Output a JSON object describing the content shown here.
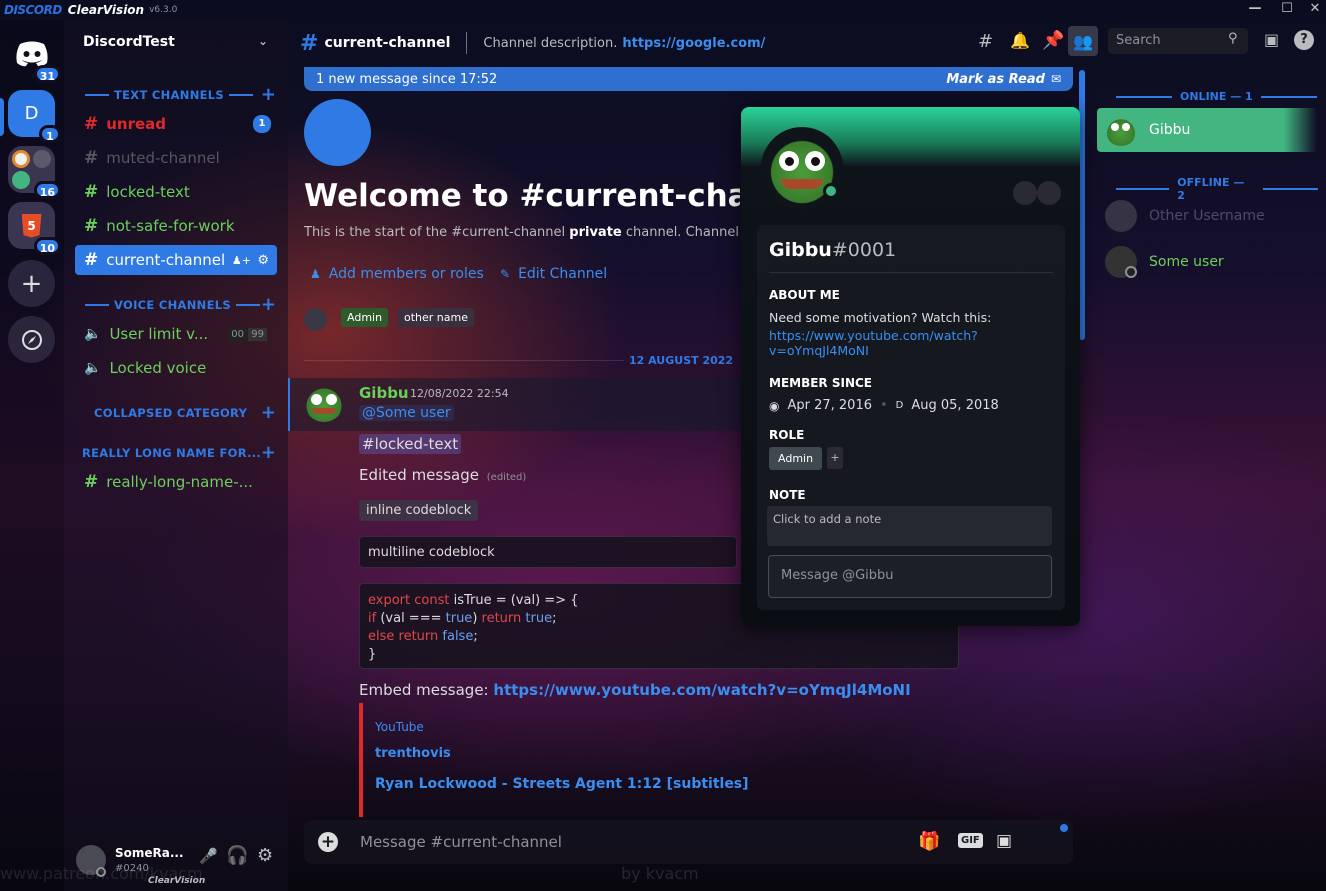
{
  "app": {
    "brand": "DISCORD",
    "name": "ClearVision",
    "version": "v6.3.0"
  },
  "window": {
    "minimize": "—",
    "maximize": "☐",
    "close": "✕"
  },
  "servers": [
    {
      "name": "home",
      "badge": "31"
    },
    {
      "name": "D",
      "badge": "1"
    },
    {
      "name": "overwatch-folder",
      "badge": "16"
    },
    {
      "name": "html5",
      "badge": "10"
    },
    {
      "name": "add-server",
      "label": "+"
    },
    {
      "name": "explore",
      "label": "⊘"
    }
  ],
  "guild": {
    "name": "DiscordTest"
  },
  "categories": {
    "text": "TEXT CHANNELS",
    "voice": "VOICE CHANNELS",
    "collapsed": "COLLAPSED CATEGORY",
    "long": "REALLY LONG NAME FOR..."
  },
  "channels": {
    "unread": {
      "name": "unread",
      "badge": "1"
    },
    "muted": {
      "name": "muted-channel"
    },
    "locked": {
      "name": "locked-text"
    },
    "nsfw": {
      "name": "not-safe-for-work"
    },
    "current": {
      "name": "current-channel"
    },
    "voice_limit": {
      "name": "User limit v...",
      "count": "00",
      "limit": "99"
    },
    "locked_voice": {
      "name": "Locked voice"
    },
    "long": {
      "name": "really-long-name-..."
    }
  },
  "user_panel": {
    "name": "SomeRa...",
    "tag": "#0240",
    "footer": "ClearVision"
  },
  "header": {
    "channel": "current-channel",
    "description": "Channel description.",
    "link": "https://google.com/",
    "search_placeholder": "Search"
  },
  "banner": {
    "text": "1 new message since 17:52",
    "action": "Mark as Read"
  },
  "welcome": {
    "title": "Welcome to #current-channel",
    "subtitle_a": "This is the start of the #current-channel ",
    "subtitle_b": "private",
    "subtitle_c": " channel. Channel d",
    "add_members": "Add members or roles",
    "edit_channel": "Edit Channel",
    "roles": [
      "Admin",
      "other name"
    ]
  },
  "divider": {
    "date": "12 AUGUST 2022"
  },
  "message": {
    "author": "Gibbu",
    "timestamp": "12/08/2022 22:54",
    "mention": "@Some user",
    "channel_mention": "#locked-text",
    "edited_text": "Edited message",
    "edited_tag": "(edited)",
    "inline_code": "inline codeblock",
    "multiline_code": "multiline codeblock",
    "code_lines": {
      "l1_kw": "export const",
      "l1_rest": " isTrue = (val) => {",
      "l2_a": "  if",
      "l2_b": " (val === ",
      "l2_c": "true",
      "l2_d": ") ",
      "l2_e": "return",
      "l2_f": " true",
      "l2_g": ";",
      "l3_a": "  else return",
      "l3_b": " false",
      "l3_c": ";",
      "l4": "}"
    },
    "embed_label": "Embed message:",
    "embed_link": "https://www.youtube.com/watch?v=oYmqJl4MoNI",
    "embed_provider": "YouTube",
    "embed_author": "trenthovis",
    "embed_title": "Ryan Lockwood - Streets Agent 1:12 [subtitles]"
  },
  "popout": {
    "username": "Gibbu",
    "discriminator": "#0001",
    "about_label": "ABOUT ME",
    "about_text": "Need some motivation? Watch this:",
    "about_link_1": "https://www.youtube.com/watch?",
    "about_link_2": "v=oYmqJl4MoNI",
    "member_since_label": "MEMBER SINCE",
    "discord_date": "Apr 27, 2016",
    "server_date": "Aug 05, 2018",
    "server_initial": "D",
    "role_label": "ROLE",
    "role": "Admin",
    "role_add": "+",
    "note_label": "NOTE",
    "note_placeholder": "Click to add a note",
    "message_placeholder": "Message @Gibbu"
  },
  "members": {
    "online_label": "ONLINE — 1",
    "offline_label": "OFFLINE — 2",
    "online": [
      {
        "name": "Gibbu"
      }
    ],
    "offline": [
      {
        "name": "Other Username"
      },
      {
        "name": "Some user"
      }
    ]
  },
  "input": {
    "placeholder": "Message #current-channel",
    "gif": "GIF"
  },
  "watermark": {
    "left": "www.patreon.com/kvacm",
    "right": "by kvacm"
  },
  "colors": {
    "accent": "#2f7ae5",
    "online": "#43b581",
    "unread": "#e02a2a",
    "green_text": "#6bd05a"
  }
}
